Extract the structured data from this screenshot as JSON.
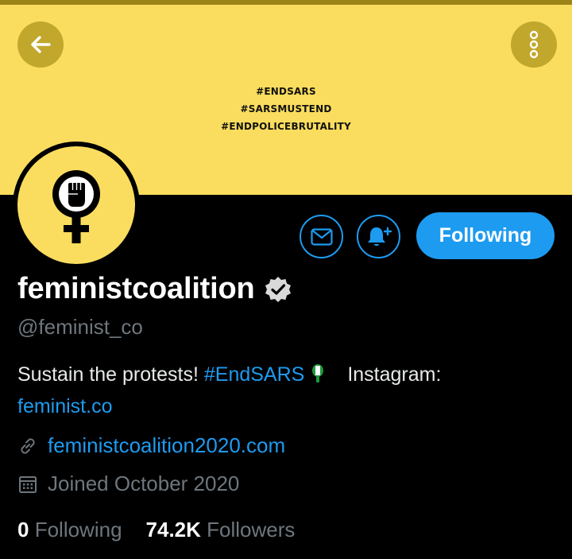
{
  "banner": {
    "lines": [
      "#ENDSARS",
      "#SARSMUSTEND",
      "#ENDPOLICEBRUTALITY"
    ],
    "background": "#fadd5e"
  },
  "nav": {
    "back_icon": "arrow-left-icon",
    "more_icon": "more-vertical-icon"
  },
  "profile": {
    "display_name": "feministcoalition",
    "verified": true,
    "handle": "@feminist_co",
    "bio": {
      "text": "Sustain the protests! ",
      "hashtag": "#EndSARS",
      "after_hashtag": "Instagram:",
      "instagram_link": "feminist.co"
    },
    "website": "feministcoalition2020.com",
    "joined": "Joined October 2020"
  },
  "actions": {
    "message_icon": "envelope-icon",
    "notify_icon": "bell-plus-icon",
    "following_label": "Following"
  },
  "stats": {
    "following_count": "0",
    "following_label": "Following",
    "followers_count": "74.2K",
    "followers_label": "Followers"
  },
  "colors": {
    "accent": "#1d9bf0",
    "muted": "#6e767d",
    "banner": "#fadd5e",
    "banner_button": "#c2a72d"
  }
}
